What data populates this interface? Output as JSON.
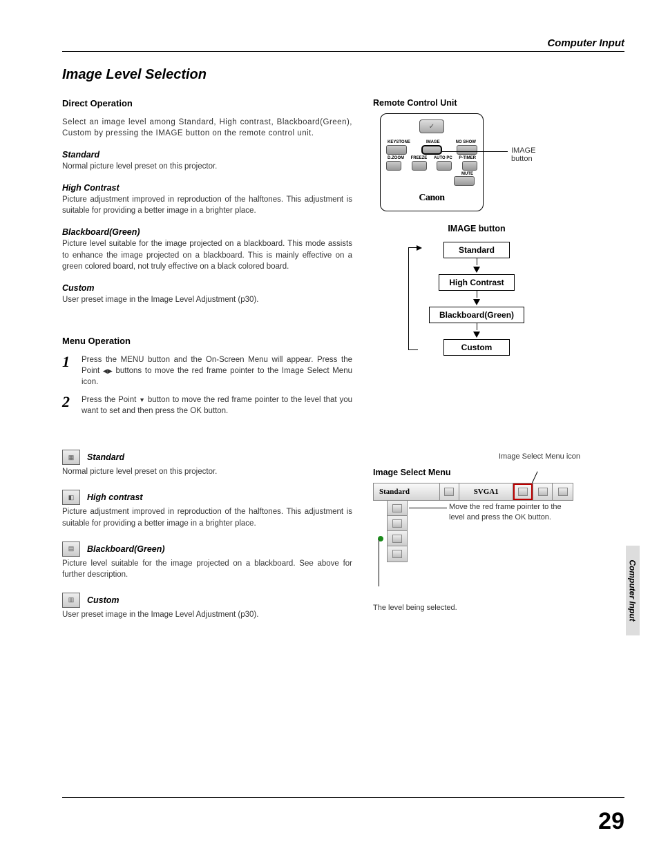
{
  "header": {
    "section": "Computer Input"
  },
  "title": "Image Level Selection",
  "direct": {
    "heading": "Direct Operation",
    "intro": "Select an image level among Standard, High contrast, Blackboard(Green), Custom by pressing the IMAGE button on the remote control unit.",
    "modes": {
      "standard": {
        "title": "Standard",
        "desc": "Normal picture level preset on this projector."
      },
      "high_contrast": {
        "title": "High Contrast",
        "desc": "Picture adjustment improved in reproduction of the halftones. This adjustment is suitable for providing a better image in a brighter place."
      },
      "blackboard": {
        "title": "Blackboard(Green)",
        "desc": "Picture level suitable for the image projected on a blackboard. This mode assists to enhance the image projected on a blackboard.  This is mainly effective on a green colored board, not truly effective on a black colored board."
      },
      "custom": {
        "title": "Custom",
        "desc": "User preset image in the Image Level Adjustment (p30)."
      }
    }
  },
  "menu": {
    "heading": "Menu Operation",
    "steps": [
      {
        "num": "1",
        "text_a": "Press the MENU button and the On-Screen Menu will appear.  Press the Point ",
        "text_b": " buttons to move the red frame pointer to the Image Select Menu icon."
      },
      {
        "num": "2",
        "text_a": "Press the Point ",
        "text_b": " button to move the red frame pointer to the level that you want to set and then press the OK button."
      }
    ],
    "icons": {
      "standard": {
        "title": "Standard",
        "desc": "Normal picture level preset on this projector."
      },
      "high_contrast": {
        "title": "High contrast",
        "desc": "Picture adjustment improved in reproduction of the halftones. This adjustment is suitable for providing a better image in a brighter place."
      },
      "blackboard": {
        "title": "Blackboard(Green)",
        "desc": "Picture level suitable for the image projected on a blackboard. See above for further description."
      },
      "custom": {
        "title": "Custom",
        "desc": "User preset image in the Image Level Adjustment (p30)."
      }
    }
  },
  "remote": {
    "title": "Remote Control Unit",
    "row1": [
      "KEYSTONE",
      "IMAGE",
      "NO SHOW"
    ],
    "row2": [
      "D.ZOOM",
      "FREEZE",
      "AUTO PC",
      "P-TIMER"
    ],
    "mute": "MUTE",
    "logo": "Canon",
    "callout": "IMAGE button"
  },
  "cycle": {
    "title": "IMAGE button",
    "items": [
      "Standard",
      "High Contrast",
      "Blackboard(Green)",
      "Custom"
    ]
  },
  "image_select": {
    "icon_label": "Image Select Menu icon",
    "title": "Image Select Menu",
    "bar_standard": "Standard",
    "bar_svga": "SVGA1",
    "callout": "Move the red frame pointer to the level and press the OK button.",
    "below": "The level being selected."
  },
  "side_tab": "Computer Input",
  "page_number": "29"
}
